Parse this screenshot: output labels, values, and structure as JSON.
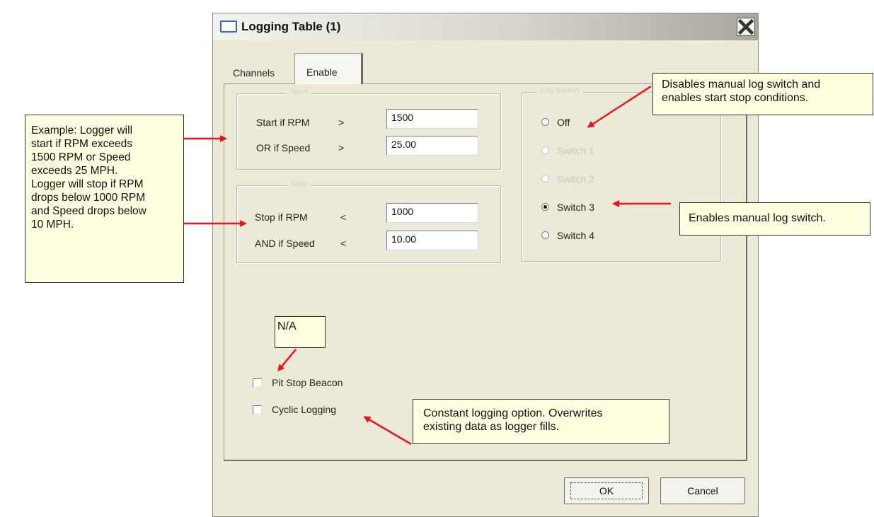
{
  "dialog": {
    "title": "Logging Table (1)",
    "tabs": [
      {
        "label": "Channels",
        "active": false
      },
      {
        "label": "Enable",
        "active": true
      }
    ],
    "start_group": {
      "fields": [
        {
          "label": "Start if RPM",
          "operator": ">",
          "value": "1500"
        },
        {
          "label": "OR if Speed",
          "operator": ">",
          "value": "25.00"
        }
      ]
    },
    "stop_group": {
      "fields": [
        {
          "label": "Stop if RPM",
          "operator": "<",
          "value": "1000"
        },
        {
          "label": "AND if Speed",
          "operator": "<",
          "value": "10.00"
        }
      ]
    },
    "switch_group": {
      "options": [
        {
          "label": "Off",
          "selected": false,
          "enabled": true
        },
        {
          "label": "Switch 1",
          "selected": false,
          "enabled": false
        },
        {
          "label": "Switch 2",
          "selected": false,
          "enabled": false
        },
        {
          "label": "Switch 3",
          "selected": true,
          "enabled": true
        },
        {
          "label": "Switch 4",
          "selected": false,
          "enabled": true
        }
      ]
    },
    "checkboxes": [
      {
        "label": "Pit Stop Beacon",
        "checked": false
      },
      {
        "label": "Cyclic Logging",
        "checked": false
      }
    ],
    "buttons": {
      "ok": "OK",
      "cancel": "Cancel"
    }
  },
  "callouts": {
    "example_lines": [
      "Example: Logger will",
      "start if RPM exceeds",
      "1500 RPM or Speed",
      "exceeds 25 MPH.",
      "Logger will stop if RPM",
      "drops below 1000 RPM",
      "and Speed drops below",
      "10 MPH."
    ],
    "off_lines": [
      "Disables manual log switch and",
      "enables start stop conditions."
    ],
    "switch3": "Enables manual log switch.",
    "na": "N/A",
    "cyclic_lines": [
      "Constant logging option. Overwrites",
      "existing data as logger fills."
    ]
  },
  "colors": {
    "arrow": "#e8141a",
    "callout_bg": "#ffffe1",
    "dialog_bg": "#ece9d8"
  }
}
